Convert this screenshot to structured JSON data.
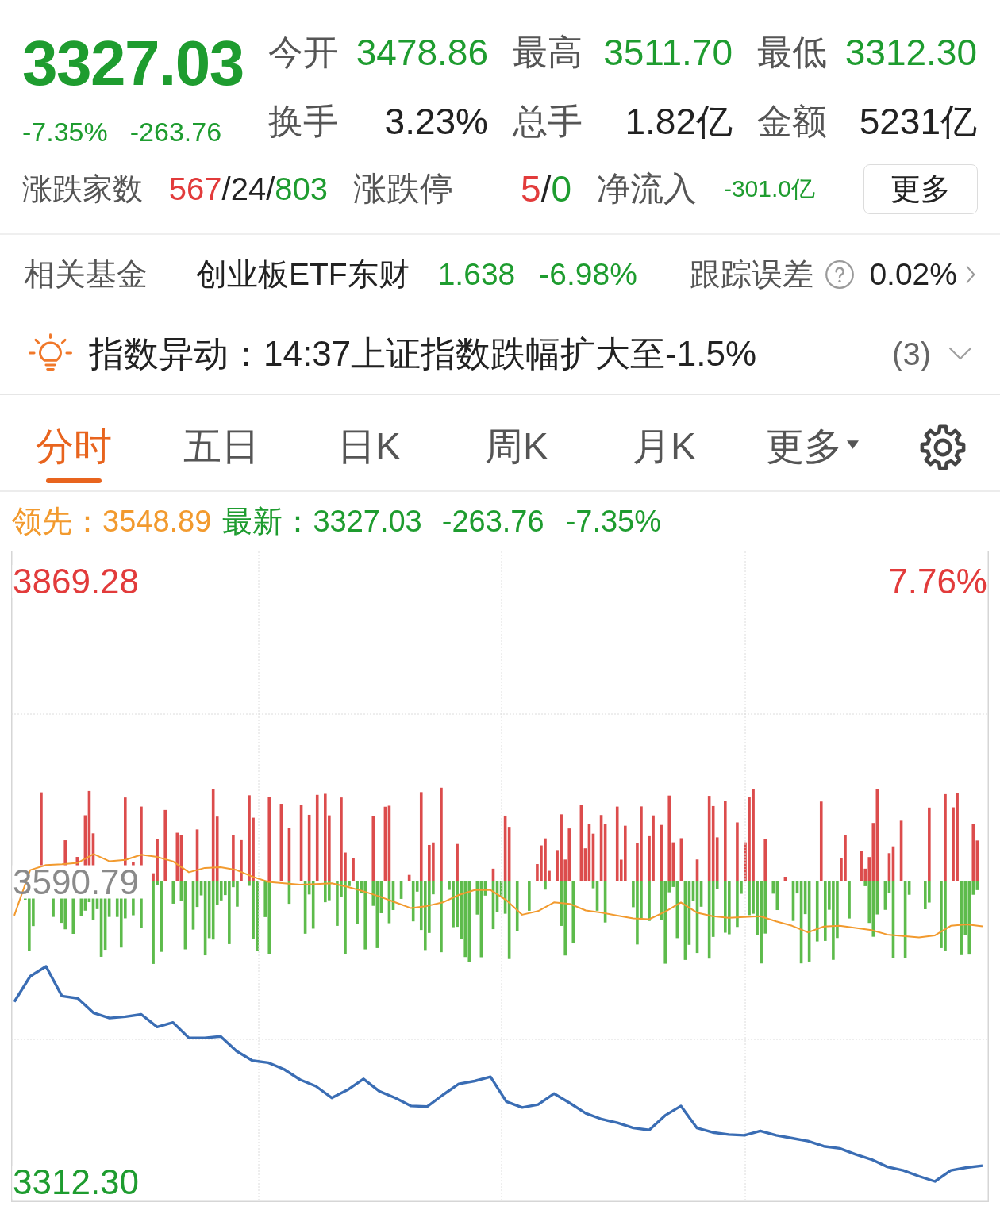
{
  "quote": {
    "price": "3327.03",
    "color": "#1e9c2f",
    "change_pct": "-7.35%",
    "change": "-263.76",
    "stats": [
      {
        "label": "今开",
        "value": "3478.86",
        "color": "#1e9c2f"
      },
      {
        "label": "最高",
        "value": "3511.70",
        "color": "#1e9c2f"
      },
      {
        "label": "最低",
        "value": "3312.30",
        "color": "#1e9c2f"
      },
      {
        "label": "换手",
        "value": "3.23%",
        "color": "#222222"
      },
      {
        "label": "总手",
        "value": "1.82亿",
        "color": "#222222"
      },
      {
        "label": "金额",
        "value": "5231亿",
        "color": "#222222"
      }
    ]
  },
  "breadth": {
    "items": [
      {
        "label": "涨跌家数",
        "parts": [
          {
            "text": "567",
            "color": "#e23b3b"
          },
          {
            "text": "/24/",
            "color": "#222222"
          },
          {
            "text": "803",
            "color": "#1e9c2f"
          }
        ]
      },
      {
        "label": "涨跌停",
        "parts": [
          {
            "text": "5",
            "color": "#e23b3b"
          },
          {
            "text": "/",
            "color": "#222222"
          },
          {
            "text": "0",
            "color": "#1e9c2f"
          }
        ]
      },
      {
        "label": "净流入",
        "parts": [
          {
            "text": "-301.0亿",
            "color": "#1e9c2f"
          }
        ]
      }
    ],
    "more_button": "更多"
  },
  "related_fund": {
    "label": "相关基金",
    "name": "创业板ETF东财",
    "price": "1.638",
    "change_pct": "-6.98%",
    "color": "#1e9c2f",
    "tracking_label": "跟踪误差",
    "tracking_error": "0.02%"
  },
  "alert": {
    "text": "指数异动：14:37上证指数跌幅扩大至-1.5%",
    "count": "(3)",
    "expanded": false
  },
  "tabs": [
    {
      "label": "分时",
      "selected": true,
      "kind": "tab"
    },
    {
      "label": "五日",
      "selected": false,
      "kind": "tab"
    },
    {
      "label": "日K",
      "selected": false,
      "kind": "tab"
    },
    {
      "label": "周K",
      "selected": false,
      "kind": "tab"
    },
    {
      "label": "月K",
      "selected": false,
      "kind": "tab"
    },
    {
      "label": "更多",
      "selected": false,
      "kind": "dropdown"
    }
  ],
  "chart": {
    "legend": [
      {
        "label": "领先：",
        "value": "3548.89",
        "color": "#f29a2e"
      },
      {
        "label": "最新：",
        "value": "3327.03",
        "color": "#1e9c2f"
      }
    ],
    "change": "-263.76",
    "change_pct": "-7.35%",
    "color": "#1e9c2f",
    "upper_limit_pct": "7.76%",
    "chart_data": {
      "type": "line",
      "grid": true,
      "ylim": [
        3293.2,
        3896.5
      ],
      "yticks": [
        {
          "value": 3869.28,
          "label": "3869.28"
        },
        {
          "value": 3590.79,
          "label": "3590.79"
        },
        {
          "value": 3312.3,
          "label": "3312.30"
        }
      ],
      "series": [
        {
          "color": "#f29a2e",
          "values": [
            3558.9,
            3601.0,
            3605.7,
            3606.4,
            3607.8,
            3615.9,
            3609.1,
            3610.5,
            3615.3,
            3613.2,
            3609.1,
            3599.0,
            3603.0,
            3603.7,
            3601.0,
            3594.9,
            3590.1,
            3588.8,
            3587.4,
            3588.1,
            3588.8,
            3585.4,
            3581.3,
            3576.5,
            3571.1,
            3565.7,
            3567.7,
            3571.1,
            3577.9,
            3582.6,
            3582.6,
            3573.1,
            3559.6,
            3563.0,
            3571.1,
            3569.7,
            3563.6,
            3561.6,
            3558.9,
            3556.2,
            3555.5,
            3562.3,
            3571.1,
            3561.6,
            3558.2,
            3556.8,
            3557.5,
            3558.2,
            3553.4,
            3549.4,
            3543.3,
            3548.7,
            3549.4,
            3547.3,
            3545.3,
            3541.2,
            3539.9,
            3538.5,
            3540.5,
            3549.4,
            3550.7,
            3548.9
          ]
        },
        {
          "color": "#3a6db4",
          "values": [
            3478.9,
            3502.5,
            3511.7,
            3484.2,
            3482.1,
            3468.5,
            3463.8,
            3465.1,
            3467.2,
            3455.6,
            3459.7,
            3445.4,
            3445.4,
            3446.8,
            3433.2,
            3424.4,
            3422.4,
            3416.2,
            3406.7,
            3400.6,
            3389.8,
            3397.2,
            3407.4,
            3395.9,
            3389.8,
            3382.3,
            3381.6,
            3392.5,
            3402.7,
            3405.4,
            3409.4,
            3386.4,
            3380.9,
            3383.6,
            3393.8,
            3385.0,
            3375.5,
            3370.1,
            3366.7,
            3361.9,
            3359.9,
            3373.5,
            3382.3,
            3361.9,
            3357.8,
            3355.8,
            3355.1,
            3359.2,
            3355.1,
            3352.4,
            3349.7,
            3344.9,
            3342.9,
            3337.5,
            3332.7,
            3325.9,
            3322.5,
            3317.1,
            3312.3,
            3322.5,
            3325.2,
            3327.0
          ]
        }
      ]
    }
  }
}
